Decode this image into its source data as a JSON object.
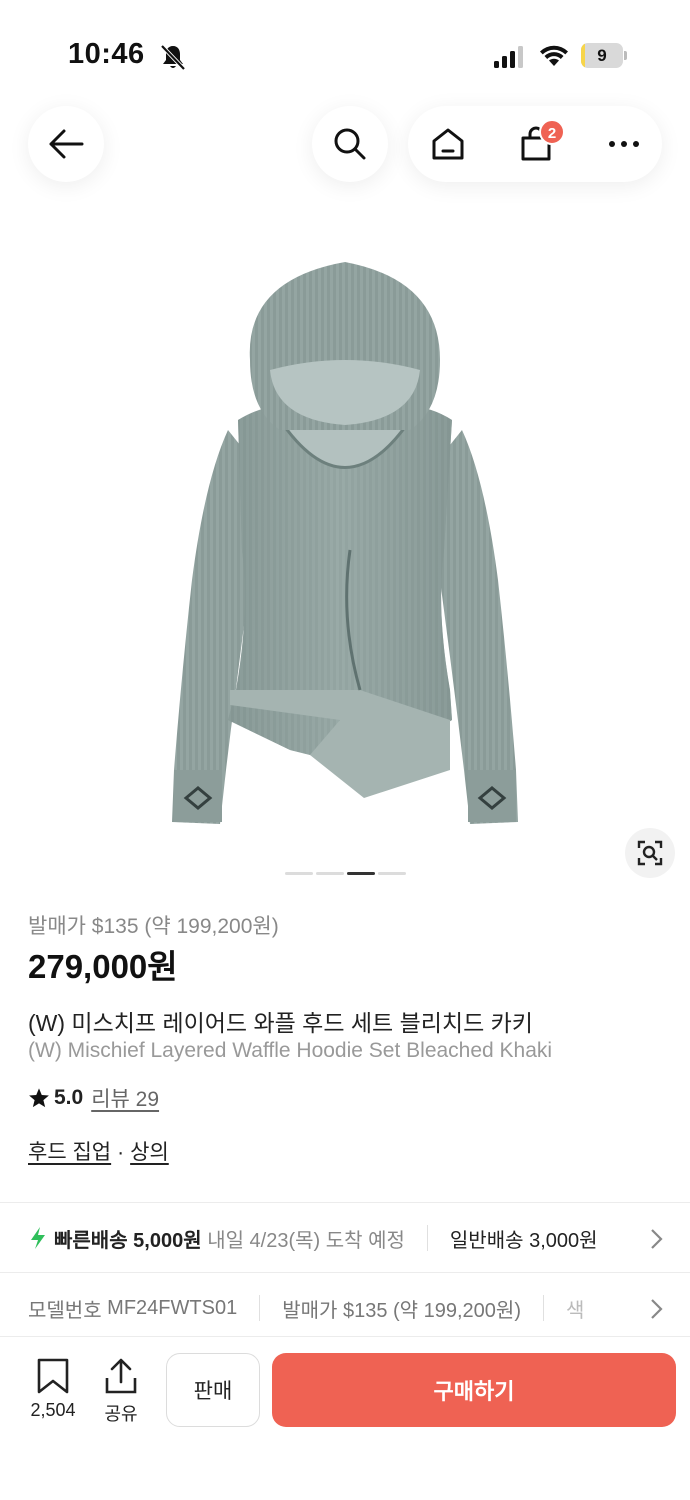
{
  "status_bar": {
    "time": "10:46",
    "battery_level": "9",
    "battery_fraction": 0.09,
    "icons": [
      "bell-slash-icon",
      "cellular-signal-icon",
      "wifi-icon",
      "battery-icon"
    ]
  },
  "header": {
    "icons": [
      "back-arrow-icon",
      "search-icon",
      "home-icon",
      "shopping-bag-icon",
      "more-icon"
    ],
    "cart_count": "2"
  },
  "gallery": {
    "image_alt_icon": "hoodie-product-image",
    "total_images": 4,
    "active_index": 2,
    "lens_icon": "image-search-icon"
  },
  "product": {
    "release_price": "발매가 $135 (약 199,200원)",
    "price": "279,000원",
    "name_kr": "(W) 미스치프 레이어드 와플 후드 세트 블리치드 카키",
    "name_en": "(W) Mischief Layered Waffle Hoodie Set Bleached Khaki",
    "rating": "5.0",
    "review_label": "리뷰 29",
    "category_1": "후드 집업",
    "category_sep": "·",
    "category_2": "상의"
  },
  "delivery": {
    "fast_label": "빠른배송",
    "fast_price": "5,000원",
    "fast_eta": "내일 4/23(목) 도착 예정",
    "normal_label": "일반배송",
    "normal_price": "3,000원"
  },
  "details": {
    "model_label": "모델번호",
    "model_value": "MF24FWTS01",
    "release_label": "발매가",
    "release_value": "$135 (약 199,200원)",
    "color_label": "색"
  },
  "bottom_bar": {
    "save_count": "2,504",
    "share_label": "공유",
    "sell_label": "판매",
    "buy_label": "구매하기"
  },
  "colors": {
    "accent": "#ef6253",
    "fast_delivery": "#2fbf5b",
    "text_primary": "#222222",
    "text_muted": "#888888"
  }
}
